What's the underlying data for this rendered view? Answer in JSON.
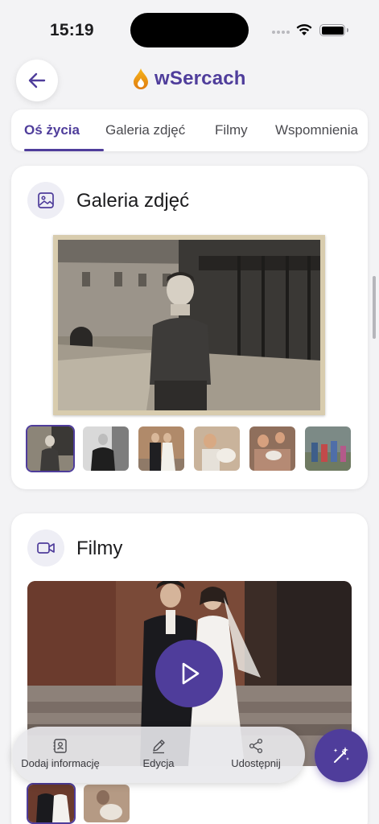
{
  "status": {
    "time": "15:19"
  },
  "header": {
    "logo_text": "wSercach",
    "back_icon": "arrow-left-icon"
  },
  "tabs": [
    {
      "label": "Oś życia",
      "active": true
    },
    {
      "label": "Galeria zdjęć",
      "active": false
    },
    {
      "label": "Filmy",
      "active": false
    },
    {
      "label": "Wspomnienia",
      "active": false
    }
  ],
  "gallery": {
    "title": "Galeria zdjęć",
    "icon": "image-icon",
    "thumb_count": 6,
    "selected_thumb": 0
  },
  "films": {
    "title": "Filmy",
    "icon": "video-icon",
    "play_icon": "play-icon"
  },
  "toolbar": {
    "items": [
      {
        "label": "Dodaj informację",
        "icon": "id-card-icon"
      },
      {
        "label": "Edycja",
        "icon": "pencil-icon"
      },
      {
        "label": "Udostępnij",
        "icon": "share-icon"
      }
    ],
    "fab_icon": "magic-wand-icon"
  },
  "colors": {
    "accent": "#4f3d9b",
    "background": "#f3f3f5",
    "card": "#ffffff"
  }
}
